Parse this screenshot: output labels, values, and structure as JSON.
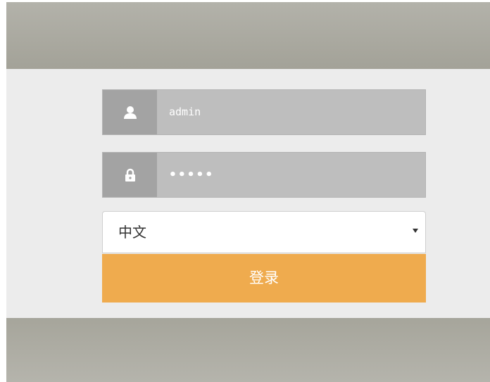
{
  "login": {
    "username_value": "admin",
    "password_value": "•••••",
    "language_selected": "中文",
    "login_button_label": "登录"
  },
  "icons": {
    "username": "user-icon",
    "password": "lock-icon",
    "select_arrow": "caret-down-icon"
  },
  "colors": {
    "top_band": "#a7a69c",
    "content_bg": "#ececec",
    "field_bg": "#bebebe",
    "icon_box_bg": "#a3a3a3",
    "login_button": "#efab4e"
  }
}
